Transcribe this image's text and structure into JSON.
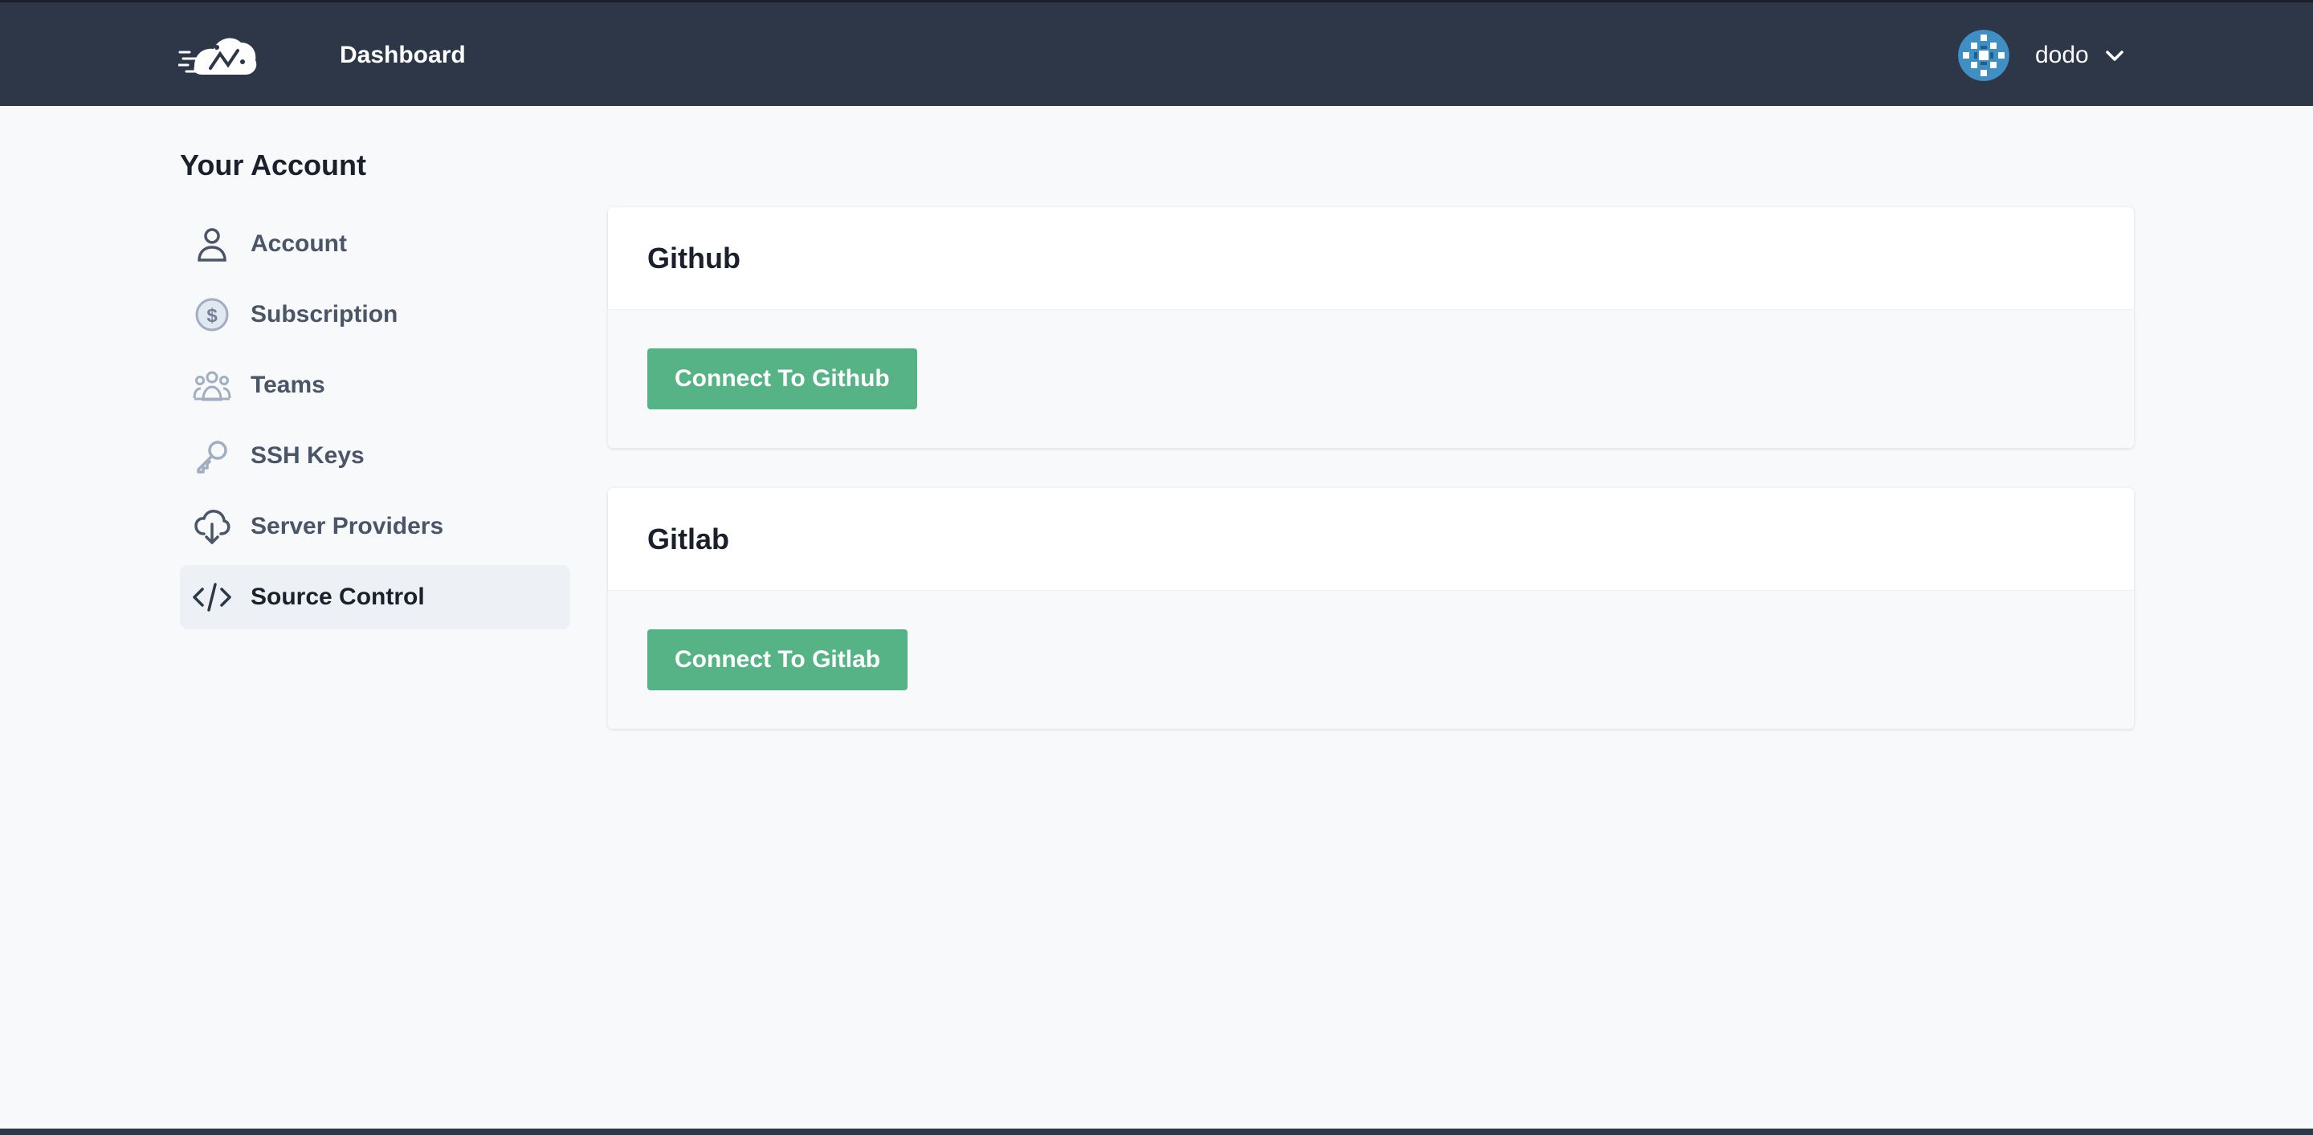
{
  "header": {
    "logo_icon": "rocket-cloud-logo",
    "nav_dashboard": "Dashboard",
    "user_name": "dodo",
    "user_menu_icon": "chevron-down-icon"
  },
  "page": {
    "title": "Your Account"
  },
  "sidebar": {
    "items": [
      {
        "label": "Account",
        "icon": "user-icon",
        "active": false
      },
      {
        "label": "Subscription",
        "icon": "dollar-circle-icon",
        "active": false
      },
      {
        "label": "Teams",
        "icon": "users-icon",
        "active": false
      },
      {
        "label": "SSH Keys",
        "icon": "key-icon",
        "active": false
      },
      {
        "label": "Server Providers",
        "icon": "cloud-download-icon",
        "active": false
      },
      {
        "label": "Source Control",
        "icon": "code-icon",
        "active": true
      }
    ]
  },
  "main": {
    "cards": [
      {
        "title": "Github",
        "button_label": "Connect To Github"
      },
      {
        "title": "Gitlab",
        "button_label": "Connect To Gitlab"
      }
    ]
  },
  "colors": {
    "topbar": "#2d3748",
    "background": "#f7f9fb",
    "button": "#56b386",
    "active_item": "#edf0f4"
  }
}
